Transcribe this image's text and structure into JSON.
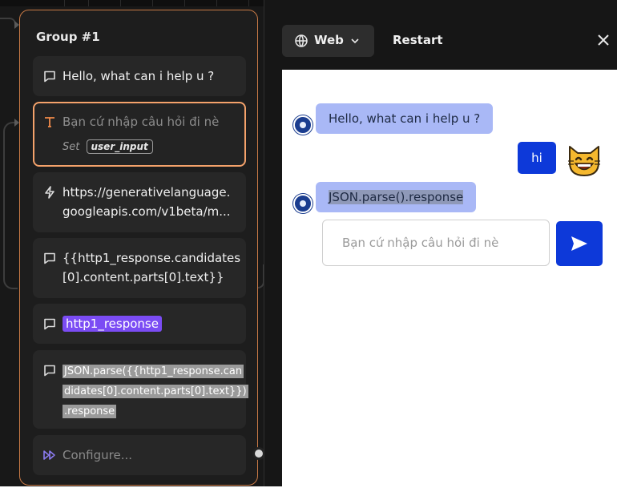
{
  "group": {
    "title": "Group #1",
    "blocks": [
      {
        "type": "text",
        "icon": "chat-bubble-icon",
        "text": "Hello, what can i help u ?"
      },
      {
        "type": "text-input",
        "icon": "text-input-icon",
        "placeholder": "Bạn cứ nhập câu hỏi đi nè",
        "set_label": "Set",
        "variable": "user_input"
      },
      {
        "type": "webhook",
        "icon": "lightning-icon",
        "text_line1": "https://generativelanguage.",
        "text_line2": "googleapis.com/v1beta/m..."
      },
      {
        "type": "text",
        "icon": "chat-bubble-icon",
        "text_line1": "{{http1_response.candidates",
        "text_line2": "[0].content.parts[0].text}}"
      },
      {
        "type": "text",
        "icon": "chat-bubble-icon",
        "variable": "http1_response"
      },
      {
        "type": "text",
        "icon": "chat-bubble-icon",
        "line1": "JSON.parse({{http1_response.can",
        "line2": "didates[0].content.parts[0].text}})",
        "line3": ".response"
      },
      {
        "type": "configure",
        "icon": "double-play-icon",
        "text": "Configure..."
      }
    ]
  },
  "preview": {
    "web_label": "Web",
    "restart_label": "Restart",
    "messages": [
      {
        "from": "bot",
        "text": "Hello, what can i help u ?"
      },
      {
        "from": "user",
        "text": "hi"
      },
      {
        "from": "bot",
        "text": "JSON.parse().response"
      }
    ],
    "input_placeholder": "Bạn cứ nhập câu hỏi đi nè"
  },
  "colors": {
    "accent_orange": "#f4a26b",
    "variable_purple": "#7b4cf4",
    "bot_bubble": "#a9b8f6",
    "user_bubble": "#0d39d9"
  }
}
